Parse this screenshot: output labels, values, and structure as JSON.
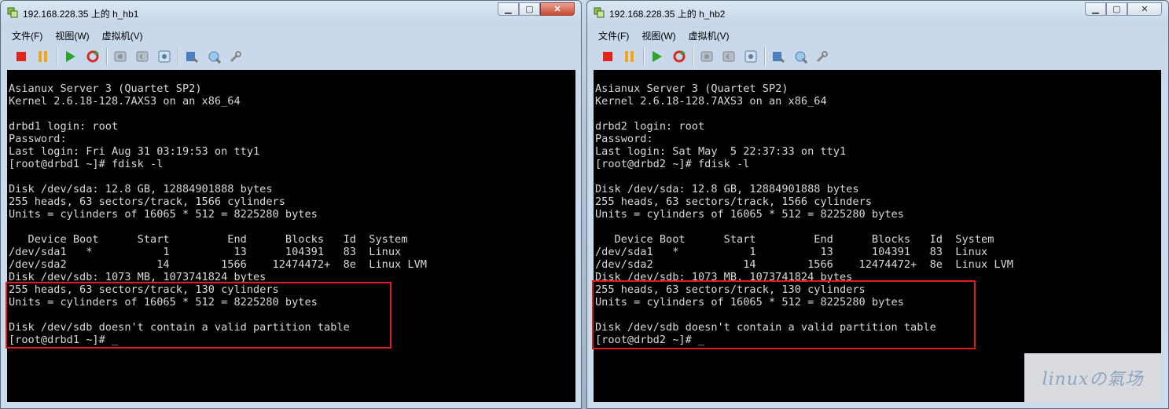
{
  "windows": [
    {
      "title": "192.168.228.35 上的 h_hb1",
      "menu": [
        "文件(F)",
        "视图(W)",
        "虚拟机(V)"
      ],
      "console": {
        "lines": [
          "Asianux Server 3 (Quartet SP2)",
          "Kernel 2.6.18-128.7AXS3 on an x86_64",
          "",
          "drbd1 login: root",
          "Password:",
          "Last login: Fri Aug 31 03:19:53 on tty1",
          "[root@drbd1 ~]# fdisk -l",
          "",
          "Disk /dev/sda: 12.8 GB, 12884901888 bytes",
          "255 heads, 63 sectors/track, 1566 cylinders",
          "Units = cylinders of 16065 * 512 = 8225280 bytes",
          "",
          "   Device Boot      Start         End      Blocks   Id  System",
          "/dev/sda1   *           1          13      104391   83  Linux",
          "/dev/sda2              14        1566    12474472+  8e  Linux LVM",
          "Disk /dev/sdb: 1073 MB, 1073741824 bytes",
          "255 heads, 63 sectors/track, 130 cylinders",
          "Units = cylinders of 16065 * 512 = 8225280 bytes",
          "",
          "Disk /dev/sdb doesn't contain a valid partition table",
          "[root@drbd1 ~]# _"
        ]
      }
    },
    {
      "title": "192.168.228.35 上的 h_hb2",
      "menu": [
        "文件(F)",
        "视图(W)",
        "虚拟机(V)"
      ],
      "console": {
        "lines": [
          "Asianux Server 3 (Quartet SP2)",
          "Kernel 2.6.18-128.7AXS3 on an x86_64",
          "",
          "drbd2 login: root",
          "Password:",
          "Last login: Sat May  5 22:37:33 on tty1",
          "[root@drbd2 ~]# fdisk -l",
          "",
          "Disk /dev/sda: 12.8 GB, 12884901888 bytes",
          "255 heads, 63 sectors/track, 1566 cylinders",
          "Units = cylinders of 16065 * 512 = 8225280 bytes",
          "",
          "   Device Boot      Start         End      Blocks   Id  System",
          "/dev/sda1   *           1          13      104391   83  Linux",
          "/dev/sda2              14        1566    12474472+  8e  Linux LVM",
          "Disk /dev/sdb: 1073 MB, 1073741824 bytes",
          "255 heads, 63 sectors/track, 130 cylinders",
          "Units = cylinders of 16065 * 512 = 8225280 bytes",
          "",
          "Disk /dev/sdb doesn't contain a valid partition table",
          "[root@drbd2 ~]# _"
        ]
      }
    }
  ],
  "watermark": "linuxの氣场",
  "colors": {
    "highlight": "#e01b1b",
    "console_bg": "#000000",
    "console_fg": "#d9d9d9"
  }
}
